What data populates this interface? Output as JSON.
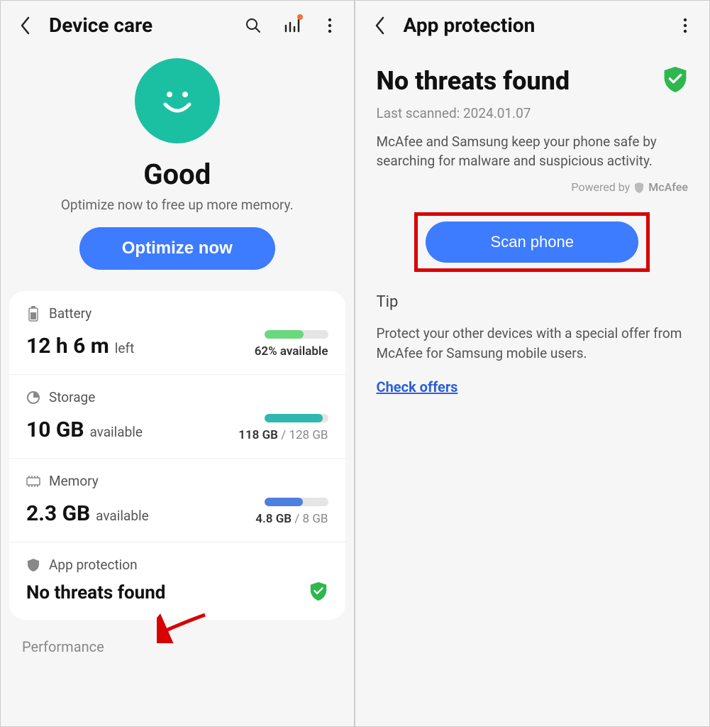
{
  "left": {
    "title": "Device care",
    "status": {
      "label": "Good",
      "sub": "Optimize now to free up more memory.",
      "button": "Optimize now"
    },
    "battery": {
      "label": "Battery",
      "value": "12 h 6 m",
      "suffix": "left",
      "right": "62% available",
      "bar_pct": 62,
      "bar_color": "#69d87e"
    },
    "storage": {
      "label": "Storage",
      "value": "10 GB",
      "suffix": "available",
      "used": "118 GB",
      "total": "128 GB",
      "bar_pct": 92,
      "bar_color": "#2fb7b0"
    },
    "memory": {
      "label": "Memory",
      "value": "2.3 GB",
      "suffix": "available",
      "used": "4.8 GB",
      "total": "8 GB",
      "bar_pct": 60,
      "bar_color": "#4d7fe0"
    },
    "protection": {
      "label": "App protection",
      "status": "No threats found"
    },
    "performance_label": "Performance"
  },
  "right": {
    "title": "App protection",
    "heading": "No threats found",
    "last_scanned": "Last scanned: 2024.01.07",
    "description": "McAfee and Samsung keep your phone safe by searching for malware and suspicious activity.",
    "powered_by": "Powered by",
    "brand": "McAfee",
    "scan_button": "Scan phone",
    "tip_label": "Tip",
    "tip_text": "Protect your other devices with a special offer from McAfee for Samsung mobile users.",
    "offers_link": "Check offers"
  }
}
